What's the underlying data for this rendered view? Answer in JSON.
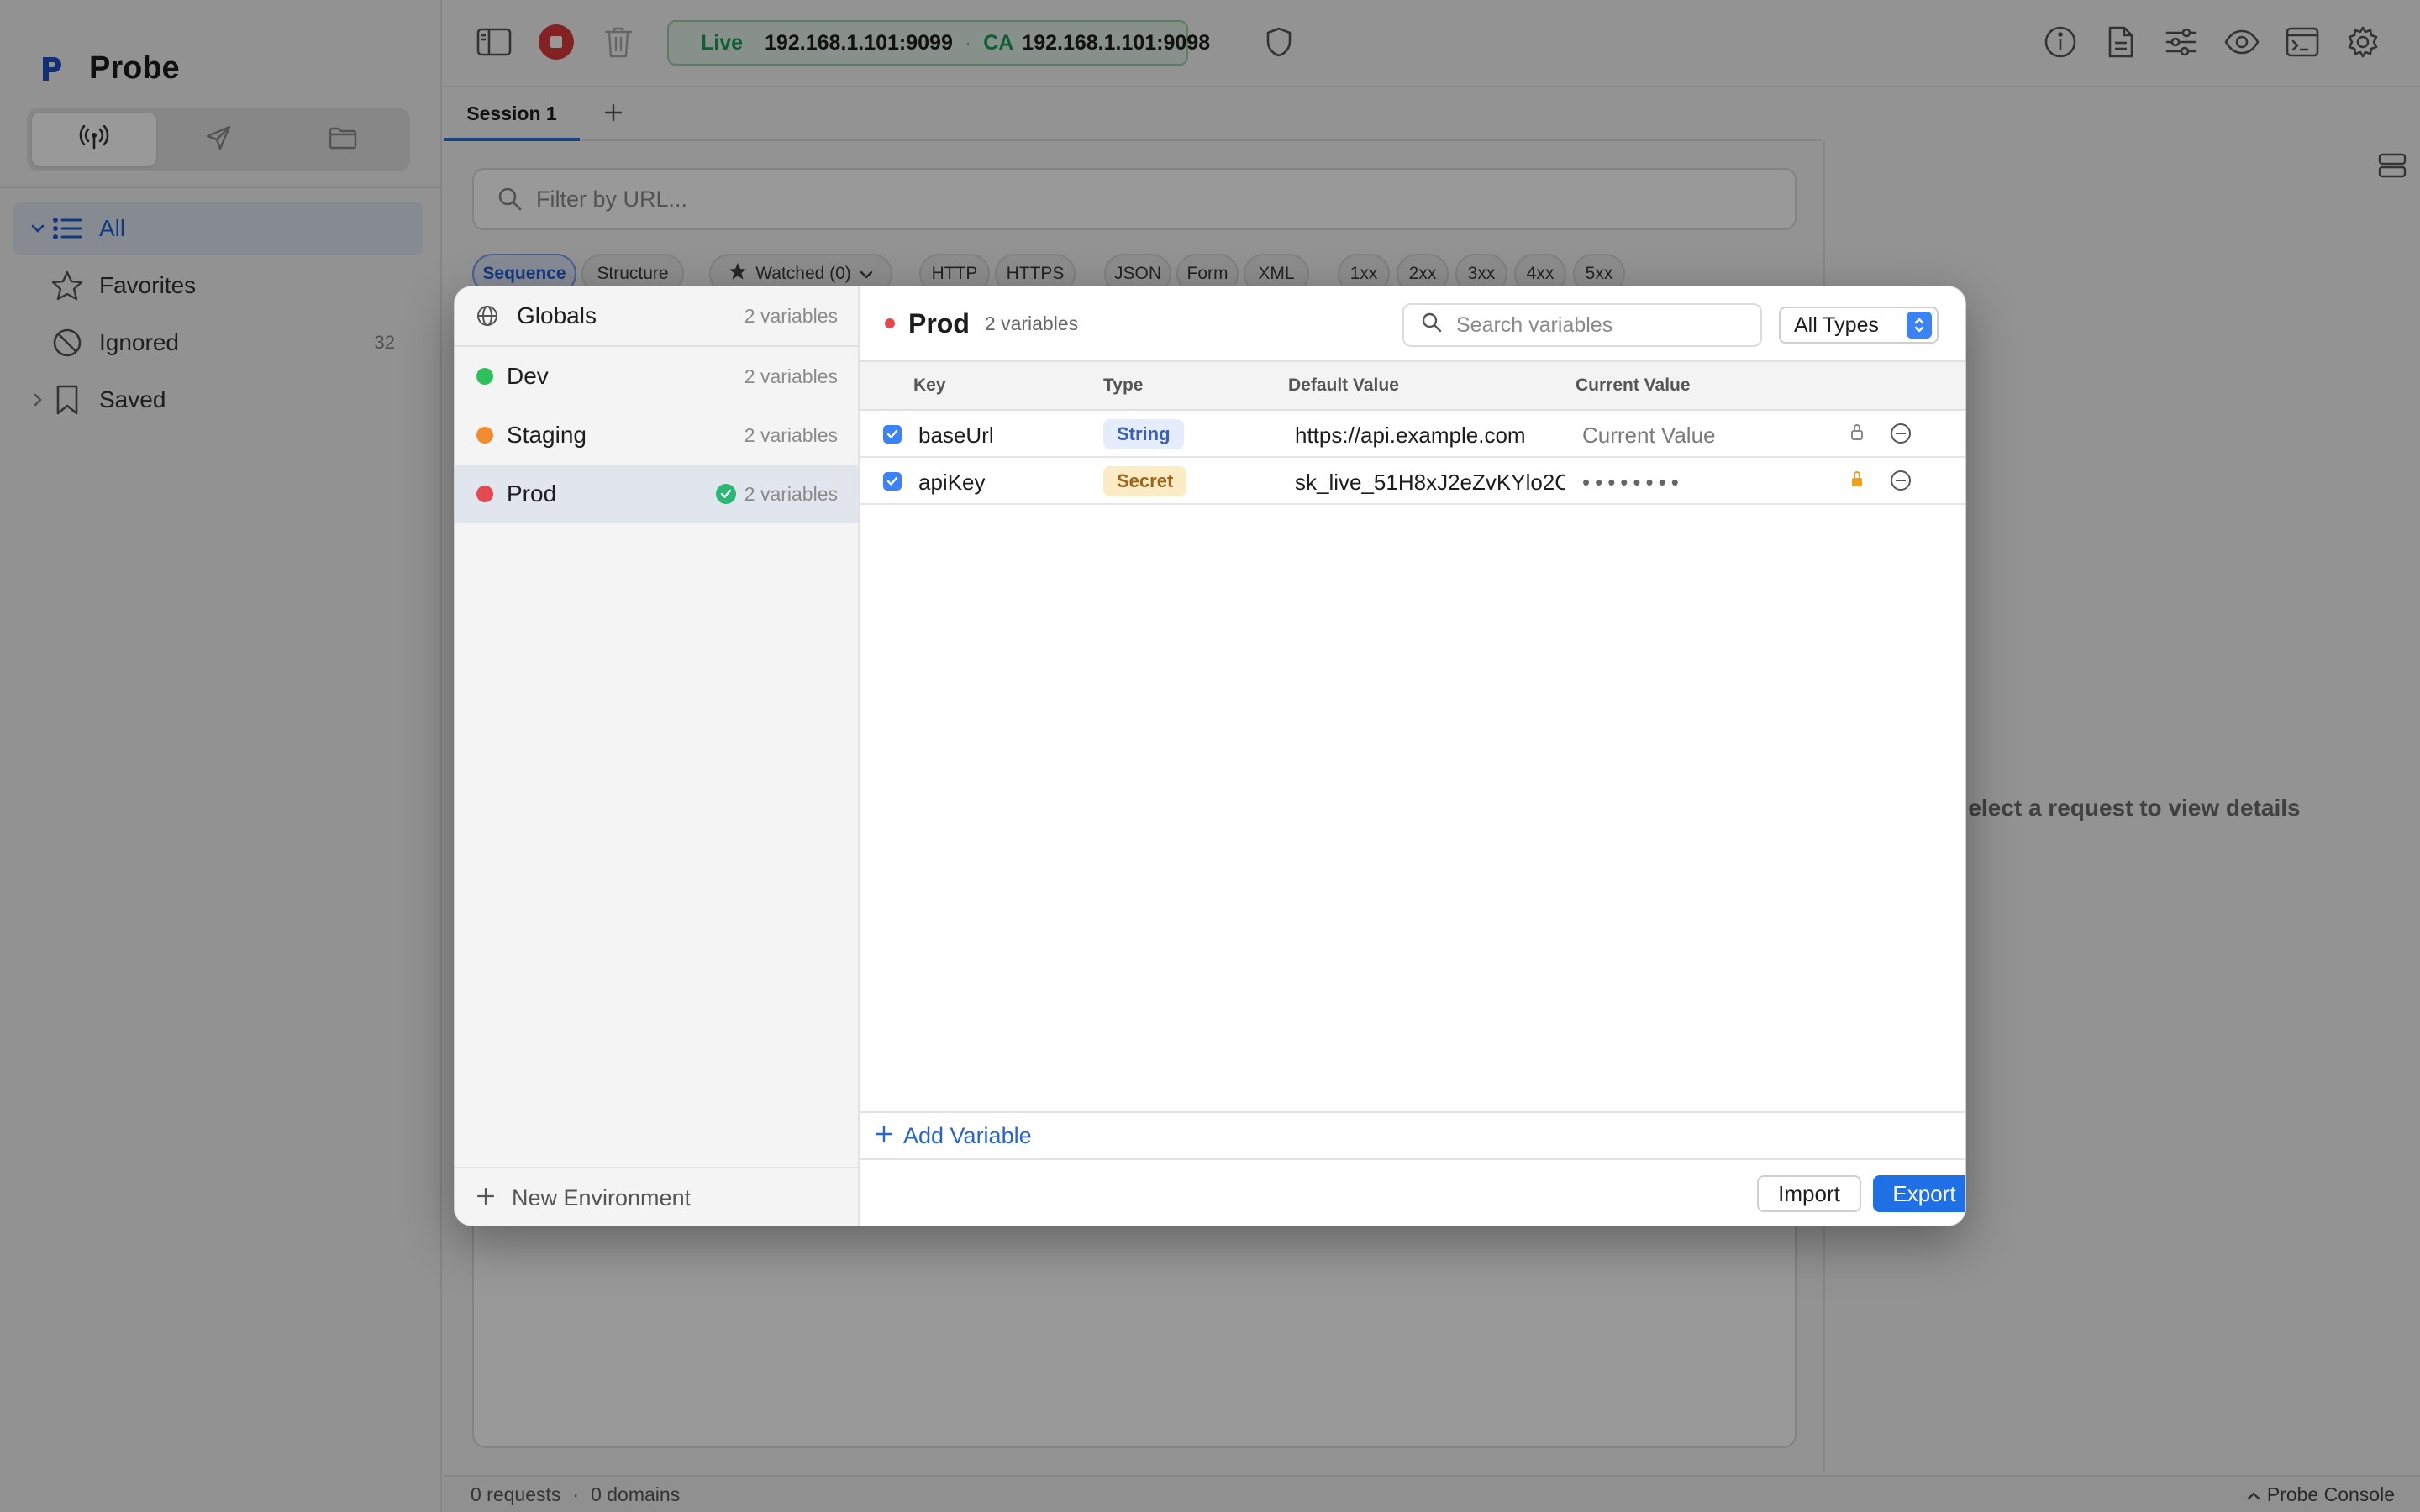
{
  "app": {
    "name": "Probe"
  },
  "sidebar": {
    "mode_tabs": [
      {
        "icon": "broadcast-icon",
        "active": true
      },
      {
        "icon": "send-icon",
        "active": false
      },
      {
        "icon": "folder-icon",
        "active": false
      }
    ],
    "items": [
      {
        "label": "All",
        "icon": "list-icon",
        "active": true,
        "expandable": true,
        "expanded": true,
        "count": ""
      },
      {
        "label": "Favorites",
        "icon": "star-icon",
        "active": false,
        "count": ""
      },
      {
        "label": "Ignored",
        "icon": "ignored-icon",
        "active": false,
        "count": "32"
      },
      {
        "label": "Saved",
        "icon": "bookmark-icon",
        "active": false,
        "expandable": true,
        "expanded": false,
        "count": ""
      }
    ]
  },
  "toolbar": {
    "live": {
      "label": "Live",
      "address": "192.168.1.101:9099",
      "separator": "·",
      "ca_label": "CA",
      "ca_address": "192.168.1.101:9098"
    },
    "icons_right": [
      "info-icon",
      "document-icon",
      "sliders-icon",
      "eye-icon",
      "terminal-icon",
      "gear-icon"
    ],
    "accent_live": "#1f9d55"
  },
  "session": {
    "tabs": [
      {
        "label": "Session 1",
        "active": true
      }
    ]
  },
  "filter": {
    "placeholder": "Filter by URL...",
    "chips": [
      {
        "label": "Sequence",
        "active": true
      },
      {
        "label": "Structure",
        "active": false
      },
      {
        "label": "Watched (0)",
        "active": false,
        "icon": "star-icon",
        "dropdown": true
      },
      {
        "label": "HTTP",
        "active": false
      },
      {
        "label": "HTTPS",
        "active": false
      },
      {
        "label": "JSON",
        "active": false
      },
      {
        "label": "Form",
        "active": false
      },
      {
        "label": "XML",
        "active": false
      },
      {
        "label": "1xx",
        "active": false
      },
      {
        "label": "2xx",
        "active": false
      },
      {
        "label": "3xx",
        "active": false
      },
      {
        "label": "4xx",
        "active": false
      },
      {
        "label": "5xx",
        "active": false
      }
    ]
  },
  "detail": {
    "empty_hint": "elect a request to view details"
  },
  "statusbar": {
    "requests": "0 requests",
    "separator": "·",
    "domains": "0 domains",
    "console": "Probe Console"
  },
  "modal": {
    "globals": {
      "label": "Globals",
      "count": "2 variables"
    },
    "environments": [
      {
        "name": "Dev",
        "count": "2 variables",
        "color": "#2fbf5b",
        "selected": false,
        "active": false
      },
      {
        "name": "Staging",
        "count": "2 variables",
        "color": "#f28b30",
        "selected": false,
        "active": false
      },
      {
        "name": "Prod",
        "count": "2 variables",
        "color": "#e5484d",
        "selected": true,
        "active": true
      }
    ],
    "new_environment": "New Environment",
    "selected_env": {
      "name": "Prod",
      "count": "2 variables",
      "search_placeholder": "Search variables",
      "type_filter": "All Types",
      "columns": {
        "key": "Key",
        "type": "Type",
        "default_value": "Default Value",
        "current_value": "Current Value"
      },
      "variables": [
        {
          "enabled": true,
          "key": "baseUrl",
          "type": "String",
          "default_value": "https://api.example.com",
          "current_value": "Current Value",
          "current_is_placeholder": true,
          "locked": false
        },
        {
          "enabled": true,
          "key": "apiKey",
          "type": "Secret",
          "default_value": "sk_live_51H8xJ2eZvKYlo2C(",
          "current_value": "••••••••",
          "current_is_placeholder": false,
          "locked": true
        }
      ]
    },
    "add_variable": "Add Variable",
    "import_label": "Import",
    "export_label": "Export"
  }
}
